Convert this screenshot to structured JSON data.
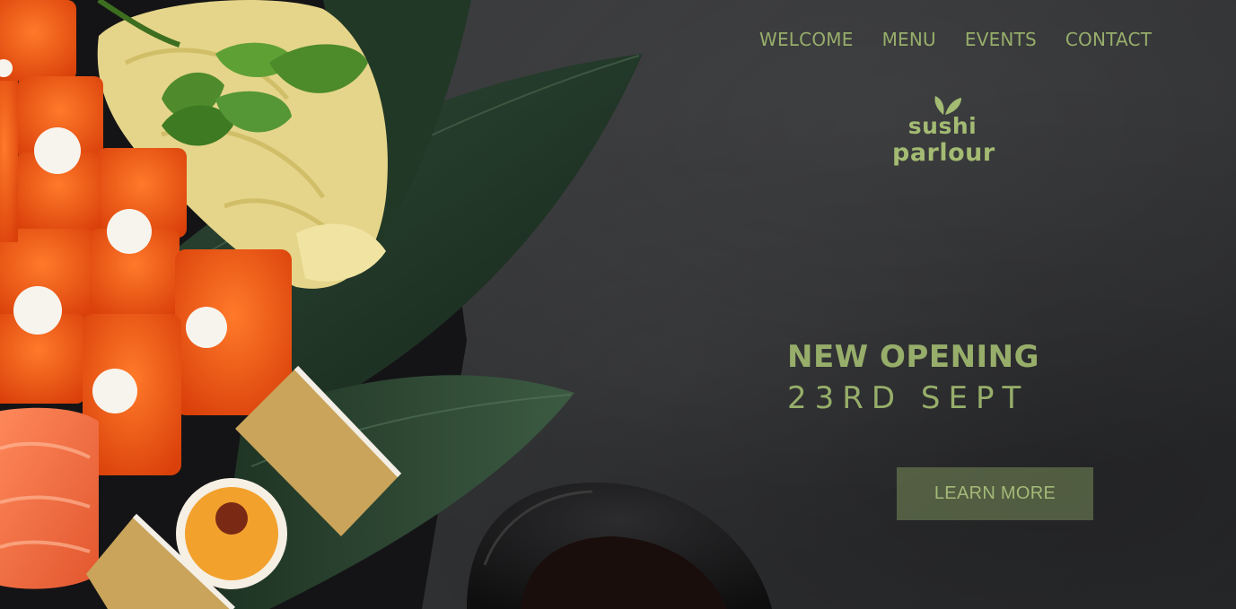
{
  "nav": {
    "items": [
      {
        "label": "WELCOME"
      },
      {
        "label": "MENU"
      },
      {
        "label": "EVENTS"
      },
      {
        "label": "CONTACT"
      }
    ]
  },
  "logo": {
    "line1": "sushi",
    "line2": "parlour"
  },
  "hero": {
    "headline": "NEW OPENING",
    "date": "23RD SEPT",
    "cta_label": "LEARN MORE"
  },
  "colors": {
    "accent": "#97ae6a",
    "background": "#3a3b3d"
  }
}
